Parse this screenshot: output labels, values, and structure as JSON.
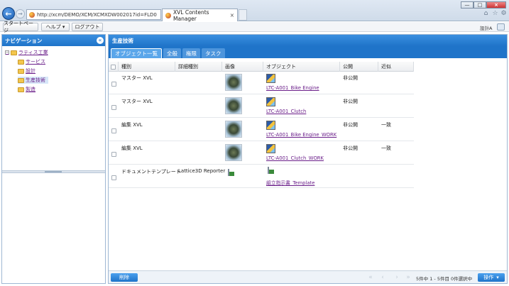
{
  "browser": {
    "url": "http://xcm/DEMO/XCM/XCMXDW002017id=FLD0",
    "tab_title": "XVL Contents Manager",
    "tab_close": "×",
    "win_min": "—",
    "win_max": "□",
    "win_close": "×"
  },
  "menubar": {
    "start_page": "スタートページ",
    "help": "ヘルプ ▾",
    "logout": "ログアウト",
    "user": "設計A"
  },
  "nav": {
    "title": "ナビゲーション",
    "collapse": "«",
    "tree": [
      {
        "label": "ラティス工業",
        "expander": "−"
      },
      {
        "label": "サービス"
      },
      {
        "label": "設計"
      },
      {
        "label": "生産技術",
        "selected": true
      },
      {
        "label": "製造"
      }
    ]
  },
  "main": {
    "title": "生産技術",
    "tabs": [
      "オブジェクト一覧",
      "全般",
      "権限",
      "タスク"
    ],
    "columns": [
      "種別",
      "詳細種別",
      "画像",
      "オブジェクト",
      "公開",
      "近似"
    ],
    "rows": [
      {
        "type": "マスター XVL",
        "detail": "",
        "object": "LTC-A001_Bike Engine",
        "publish": "非公開",
        "approx": ""
      },
      {
        "type": "マスター XVL",
        "detail": "",
        "object": "LTC-A001_Clutch",
        "publish": "非公開",
        "approx": ""
      },
      {
        "type": "編集 XVL",
        "detail": "",
        "object": "LTC-A001_Bike Engine_WORK",
        "publish": "非公開",
        "approx": "一致"
      },
      {
        "type": "編集 XVL",
        "detail": "",
        "object": "LTC-A001_Clutch_WORK",
        "publish": "非公開",
        "approx": "一致"
      },
      {
        "type": "ドキュメントテンプレート",
        "detail": "Lattice3D Reporter",
        "object": "組立指示書_Template",
        "publish": "",
        "approx": ""
      }
    ],
    "delete_button": "削除",
    "page_info": "5件中 1 - 5件目 0件選択中",
    "operation_button": "操作",
    "pager": {
      "first": "«",
      "prev": "‹",
      "next": "›",
      "last": "»"
    }
  }
}
